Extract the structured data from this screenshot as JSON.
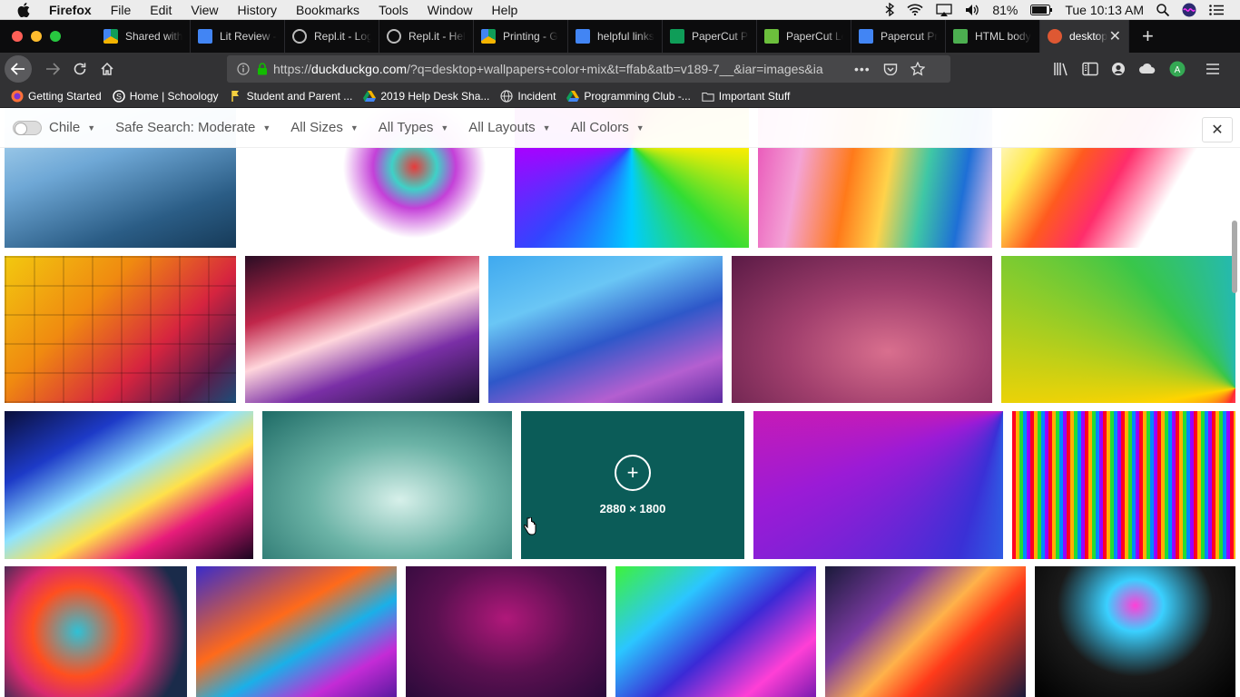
{
  "menubar": {
    "items": [
      "Firefox",
      "File",
      "Edit",
      "View",
      "History",
      "Bookmarks",
      "Tools",
      "Window",
      "Help"
    ],
    "battery": "81%",
    "clock": "Tue 10:13 AM"
  },
  "tabs": [
    {
      "title": "Shared with",
      "icon": "drive"
    },
    {
      "title": "Lit Review -",
      "icon": "docs"
    },
    {
      "title": "Repl.it - Log",
      "icon": "repl"
    },
    {
      "title": "Repl.it - Hel",
      "icon": "repl"
    },
    {
      "title": "Printing - G",
      "icon": "drive"
    },
    {
      "title": "helpful links",
      "icon": "docs"
    },
    {
      "title": "PaperCut Pr",
      "icon": "sheets"
    },
    {
      "title": "PaperCut Lo",
      "icon": "papercut"
    },
    {
      "title": "Papercut Pr",
      "icon": "docs"
    },
    {
      "title": "HTML body",
      "icon": "html"
    },
    {
      "title": "desktop",
      "icon": "ddg",
      "active": true
    }
  ],
  "url": {
    "prefix": "https://",
    "domain": "duckduckgo.com",
    "path": "/?q=desktop+wallpapers+color+mix&t=ffab&atb=v189-7__&iar=images&ia"
  },
  "bookmarks": [
    {
      "label": "Getting Started",
      "icon": "firefox"
    },
    {
      "label": "Home | Schoology",
      "icon": "schoology"
    },
    {
      "label": "Student and Parent ...",
      "icon": "flag"
    },
    {
      "label": "2019 Help Desk Sha...",
      "icon": "drive"
    },
    {
      "label": "Incident",
      "icon": "globe"
    },
    {
      "label": "Programming Club -...",
      "icon": "drive"
    },
    {
      "label": "Important Stuff",
      "icon": "folder"
    }
  ],
  "filters": {
    "region": "Chile",
    "safe_search": "Safe Search: Moderate",
    "sizes": "All Sizes",
    "types": "All Types",
    "layouts": "All Layouts",
    "colors": "All Colors"
  },
  "hover_card": {
    "dimensions": "2880 × 1800",
    "color": "#0b5c58"
  },
  "image_rows": [
    [
      {
        "bg": "linear-gradient(160deg,#bfe3f7 0%,#6fa8d6 40%,#2b5d86 75%,#163a58 100%)"
      },
      {
        "bg": "radial-gradient(circle at 65% 45%,#e83a3a 0%,#3fd1c7 12%,#c440d8 22%,#fff 38%),#fff"
      },
      {
        "bg": "conic-gradient(from 0deg at 50% 30%,#ff0033,#ff9900,#ffee00,#33dd33,#00ccff,#3344ff,#aa00ff,#ff00aa,#ff0033)"
      },
      {
        "bg": "linear-gradient(100deg,#e84fb6 0%,#f4a3d6 20%,#ff7a1a 40%,#ffd24a 55%,#3fc7a5 70%,#1e6fd6 85%,#f5c6ee 100%)"
      },
      {
        "bg": "linear-gradient(120deg,#fff 0%,#ffe94d 20%,#ff5a1f 35%,#ff2d6b 50%,#fff 70%)"
      }
    ],
    [
      {
        "bg": "repeating-linear-gradient(90deg,rgba(0,0,0,0.15) 0 2px,transparent 2px 32px),repeating-linear-gradient(0deg,rgba(0,0,0,0.15) 0 2px,transparent 2px 32px),linear-gradient(135deg,#f2c90f 0%,#f08a10 35%,#d6243f 65%,#5b1c4a 85%,#1b4e7a 100%)"
      },
      {
        "bg": "linear-gradient(160deg,#2a0d24 0%,#c0264a 30%,#ffd6dc 50%,#7a2fa6 70%,#1b1030 100%)"
      },
      {
        "bg": "linear-gradient(160deg,#3fa9ef 0%,#6ac6f5 30%,#2e58c9 55%,#b45fd0 80%,#5a2aa0 100%)"
      },
      {
        "bg": "radial-gradient(ellipse at 60% 65%,#d96f8e 0%,#a13f6d 45%,#5a1a45 100%)"
      },
      {
        "bg": "conic-gradient(from 200deg at 100% 90%,#ff2b2b,#ffd400,#39c64a,#1ab3e6,#7a3cd6,#ff4fa6,#ff2b2b)"
      }
    ],
    [
      {
        "bg": "linear-gradient(150deg,#0a0f3a 0%,#1d3ac7 25%,#8fe3ff 45%,#ffe14a 60%,#e81c7a 75%,#1a0520 100%)"
      },
      {
        "bg": "radial-gradient(ellipse at 55% 60%,#d7f0ea 0%,#6bb3a6 45%,#1e6b66 100%)"
      },
      {
        "bg": "#0b5c58"
      },
      {
        "bg": "conic-gradient(from 300deg at 100% 0%,#ff1a1a,#ff7a00,#ffe100,#4cd130,#1ab0ff,#3a30d6,#9b1bd6,#ff1a8c)"
      },
      {
        "bg": "repeating-linear-gradient(90deg,#ff0022 0 4px,#ffb000 4px 8px,#22dd33 8px 12px,#0088ff 12px 16px,#9900ff 16px 20px),linear-gradient(#000,#000)"
      }
    ],
    [
      {
        "bg": "radial-gradient(circle at 40% 50%,#2fc1d6 0%,#ff4f1f 35%,#d92a6f 55%,#1a2b4a 85%)"
      },
      {
        "bg": "linear-gradient(150deg,#3a2cc9 0%,#ff6a1a 40%,#1ab0e8 60%,#c42bd6 80%,#5a1aa0 100%)"
      },
      {
        "bg": "radial-gradient(ellipse at 50% 40%,#b0187a 0%,#5a1050 50%,#2a0a3a 100%)"
      },
      {
        "bg": "linear-gradient(140deg,#3ef23a 0%,#2bc6ff 30%,#3a2ad6 55%,#ff3fd6 80%,#7a1ab0 100%)"
      },
      {
        "bg": "linear-gradient(135deg,#1a1a3a 0%,#7a3aa0 30%,#ffb24a 50%,#ff3a1a 65%,#1a1a3a 100%)"
      },
      {
        "bg": "radial-gradient(ellipse at 50% 30%,#ff3fd6 0%,#3ad0ff 20%,#1a1a1a 55%,#000 100%)"
      }
    ]
  ]
}
